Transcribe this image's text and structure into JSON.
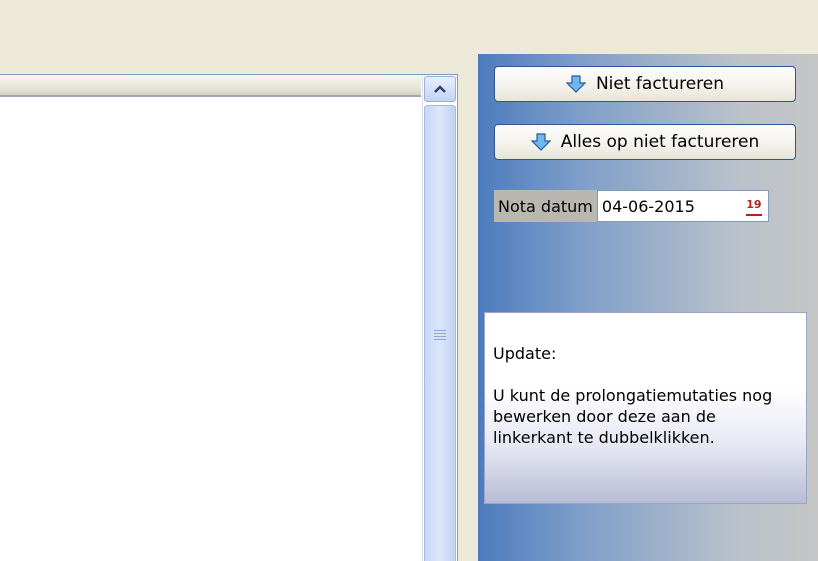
{
  "buttons": {
    "niet_factureren": "Niet factureren",
    "alles_op_niet_factureren": "Alles op niet factureren"
  },
  "nota_datum": {
    "label": "Nota datum",
    "value": "04-06-2015",
    "calendar_icon_text": "19"
  },
  "info": {
    "title": "Update:",
    "message": "U kunt de prolongatiemutaties nog bewerken door deze aan de linkerkant te dubbelklikken."
  },
  "icons": {
    "arrow": "arrow-down-icon",
    "calendar": "calendar-icon",
    "scroll_up": "chevron-up-icon"
  },
  "colors": {
    "panel_gradient_start": "#4d7bbd",
    "panel_gradient_end": "#c6c6c6",
    "button_border": "#2f5596",
    "arrow_fill": "#6fb7ee"
  }
}
